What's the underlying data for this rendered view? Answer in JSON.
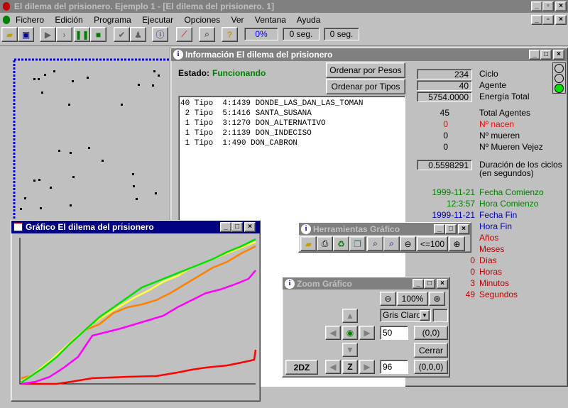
{
  "app": {
    "title": "El dilema del prisionero. Ejemplo 1 - [El dilema del prisionero. 1]",
    "menu": [
      "Fichero",
      "Edición",
      "Programa",
      "Ejecutar",
      "Opciones",
      "Ver",
      "Ventana",
      "Ayuda"
    ],
    "toolbar": {
      "progress": "0%",
      "time1": "0 seg.",
      "time2": "0 seg."
    }
  },
  "info": {
    "title": "Información El dilema del prisionero",
    "estado_label": "Estado:",
    "estado_value": "Funcionando",
    "btn_pesos": "Ordenar por Pesos",
    "btn_tipos": "Ordenar por Tipos",
    "list": [
      "40 Tipo  4:1439 DONDE_LAS_DAN_LAS_TOMAN",
      " 2 Tipo  5:1416 SANTA_SUSANA",
      " 1 Tipo  3:1270 DON_ALTERNATIVO",
      " 1 Tipo  2:1139 DON_INDECISO",
      " 1 Tipo  1:490 DON_CABRON"
    ],
    "stats": {
      "ciclo": {
        "value": "234",
        "label": "Ciclo"
      },
      "agente": {
        "value": "40",
        "label": "Agente"
      },
      "energia": {
        "value": "5754.0000",
        "label": "Energía Total"
      },
      "total_agentes": {
        "value": "45",
        "label": "Total Agentes"
      },
      "nacen": {
        "value": "0",
        "label": "Nº nacen"
      },
      "mueren": {
        "value": "0",
        "label": "Nº mueren"
      },
      "mueren_vejez": {
        "value": "0",
        "label": "Nº Mueren Vejez"
      },
      "duracion": {
        "value": "0.5598291",
        "label1": "Duración de los ciclos",
        "label2": "(en segundos)"
      },
      "fecha_comienzo": {
        "value": "1999-11-21",
        "label": "Fecha Comienzo"
      },
      "hora_comienzo": {
        "value": "12:3:57",
        "label": "Hora Comienzo"
      },
      "fecha_fin": {
        "value": "1999-11-21",
        "label": "Fecha Fin"
      },
      "hora_fin": {
        "label": "Hora Fin"
      },
      "anos": {
        "label": "Años"
      },
      "meses": {
        "label": "Meses"
      },
      "dias": {
        "value": "0",
        "label": "Días"
      },
      "horas": {
        "value": "0",
        "label": "Horas"
      },
      "minutos": {
        "value": "3",
        "label": "Minutos"
      },
      "segundos": {
        "value": "49",
        "label": "Segundos"
      }
    }
  },
  "grafico": {
    "title": "Gráfico El dilema del prisionero",
    "colors": {
      "green": "#00e000",
      "yellow": "#ffff40",
      "orange": "#ff8000",
      "magenta": "#ff00ff",
      "red": "#ff0000"
    }
  },
  "herramientas": {
    "title": "Herramientas Gráfico",
    "btn_100": "<=100"
  },
  "zoom": {
    "title": "Zoom Gráfico",
    "pct": "100%",
    "color_select": "Gris Claro",
    "field1": "50",
    "coord1": "(0,0)",
    "cerrar": "Cerrar",
    "btn_2dz": "2DZ",
    "z": "Z",
    "field2": "96",
    "coord2": "(0,0,0)"
  }
}
